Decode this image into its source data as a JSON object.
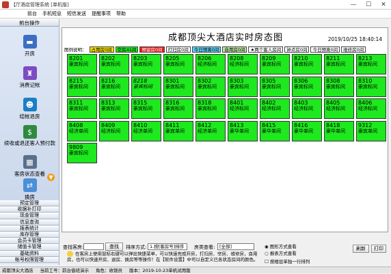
{
  "window": {
    "title": "【厅酒店管理系统 [单机版]",
    "controls": [
      "—",
      "☐",
      "✕"
    ]
  },
  "menu": [
    "前台",
    "手机短息",
    "短信发送",
    "提醒事项",
    "帮助"
  ],
  "sidebar": {
    "header": "前台操作",
    "items": [
      {
        "label": "开房",
        "icon": "bed-icon"
      },
      {
        "label": "消费记帐",
        "icon": "bottles-icon"
      },
      {
        "label": "结帐退房",
        "icon": "checkout-icon"
      },
      {
        "label": "续收或退还客人预付款",
        "icon": "money-bag-icon"
      },
      {
        "label": "客房状态查看",
        "icon": "room-status-icon"
      },
      {
        "label": "换房",
        "icon": "swap-room-icon"
      }
    ],
    "list": [
      "预定管理",
      "收据补打印",
      "现金管理",
      "信息查询",
      "报表统计",
      "库存管理",
      "会员卡管理",
      "储值卡管理",
      "基础资料",
      "帐号权限管理"
    ]
  },
  "main": {
    "title": "成都顶尖大酒店实时房态图",
    "datetime": "2019/10/25 18:40:14",
    "legend_label": "图例说明：",
    "legend": [
      {
        "label": "占用房0间",
        "bg": "#f1e000"
      },
      {
        "label": "空房41间",
        "bg": "#1ee81e"
      },
      {
        "label": "预留房0间",
        "bg": "#e31d1d"
      },
      {
        "label": "打扫房0间",
        "bg": "#ffffff"
      },
      {
        "label": "今日预离0间",
        "bg": "#5fd3f3"
      },
      {
        "label": "自用房0间",
        "bg": "#b9e7a0"
      },
      {
        "label": "★两个客人房间",
        "bg": "#ffffff"
      },
      {
        "label": "钟点房0间",
        "bg": "#ffffff"
      },
      {
        "label": "今日预离0间",
        "bg": "#ffffff"
      },
      {
        "label": "维修房0间",
        "bg": "#ffffff"
      }
    ],
    "rooms": [
      {
        "no": "8201",
        "type": "豪宾标间"
      },
      {
        "no": "8202",
        "type": "豪宾标间"
      },
      {
        "no": "8203",
        "type": "豪宾标间"
      },
      {
        "no": "8205",
        "type": "豪宾标间"
      },
      {
        "no": "8206",
        "type": "经济标间"
      },
      {
        "no": "8208",
        "type": "经济标间"
      },
      {
        "no": "8209",
        "type": "豪宾标间"
      },
      {
        "no": "8210",
        "type": "豪宾标间"
      },
      {
        "no": "8211",
        "type": "豪宾标间"
      },
      {
        "no": "8213",
        "type": "豪宾标间"
      },
      {
        "no": "8215",
        "type": "豪宾标间"
      },
      {
        "no": "8216",
        "type": "豪宾标间"
      },
      {
        "no": "8218",
        "type": "豪宾标间",
        "sel": true
      },
      {
        "no": "8301",
        "type": "豪宾标间"
      },
      {
        "no": "8302",
        "type": "豪宾标间"
      },
      {
        "no": "8303",
        "type": "豪宾标间"
      },
      {
        "no": "8305",
        "type": "豪宾标间"
      },
      {
        "no": "8306",
        "type": "豪宾标间"
      },
      {
        "no": "8308",
        "type": "豪宾标间"
      },
      {
        "no": "8310",
        "type": "豪宾标间"
      },
      {
        "no": "8311",
        "type": "豪宾标间"
      },
      {
        "no": "8313",
        "type": "豪宾标间"
      },
      {
        "no": "8315",
        "type": "豪宾标间"
      },
      {
        "no": "8316",
        "type": "豪宾标间"
      },
      {
        "no": "8318",
        "type": "豪宾标间"
      },
      {
        "no": "8401",
        "type": "经济标间"
      },
      {
        "no": "8402",
        "type": "经济标间"
      },
      {
        "no": "8403",
        "type": "经济标间"
      },
      {
        "no": "8405",
        "type": "经济标间"
      },
      {
        "no": "8406",
        "type": "经济标间"
      },
      {
        "no": "8408",
        "type": "经济单间"
      },
      {
        "no": "8409",
        "type": "经济标间"
      },
      {
        "no": "8410",
        "type": "经济单间"
      },
      {
        "no": "8411",
        "type": "豪宾单间"
      },
      {
        "no": "8412",
        "type": "经济单间"
      },
      {
        "no": "8413",
        "type": "豪华单间"
      },
      {
        "no": "8415",
        "type": "豪华单间"
      },
      {
        "no": "8416",
        "type": "豪华单间"
      },
      {
        "no": "8418",
        "type": "豪华单间"
      },
      {
        "no": "9312",
        "type": "豪宾单间"
      },
      {
        "no": "9809",
        "type": "豪宾标间"
      }
    ]
  },
  "search": {
    "room_search_label": "查找客房:",
    "room_search_value": "",
    "find_button": "查找",
    "sort_label": "排序方式:",
    "sort_value": "1.按[客房号]排序",
    "type_label": "房类查看:",
    "type_value": "[全部]",
    "radio_graph": "图形方式查看",
    "radio_report": "报表方式查看",
    "checkbox_floor": "按楼层单独一行排列",
    "refresh_button": "刷新",
    "print_button": "打印"
  },
  "note": "在客房上使用鼠标右键可以弹出快捷菜单，可以快速完成开房，打扫房、空房、维修房，自用房，也可以快速开房、退房、换房等等操作！在【软件设置】中可以自定义已各状态房间的颜色。",
  "status": [
    "成都顶尖大酒店",
    "当前工号：前台值班演示",
    "角色：收银员",
    "版本：2019-10-23单机试用版"
  ]
}
